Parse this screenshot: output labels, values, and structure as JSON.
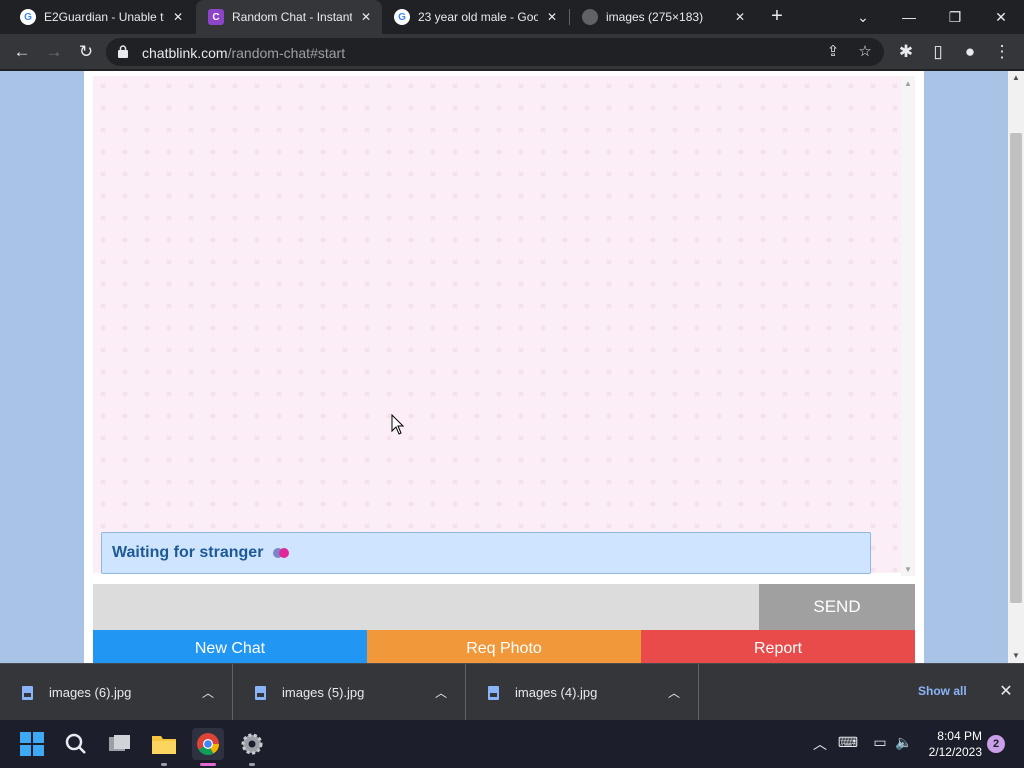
{
  "browser": {
    "tabs": [
      {
        "title": "E2Guardian - Unable to",
        "icon": "google-icon",
        "active": false
      },
      {
        "title": "Random Chat - Instant",
        "icon": "chatblink-icon",
        "active": true
      },
      {
        "title": "23 year old male - Goo",
        "icon": "google-icon",
        "active": false
      },
      {
        "title": "images (275×183)",
        "icon": "globe-icon",
        "active": false
      }
    ],
    "url_domain": "chatblink.com",
    "url_path": "/random-chat#start"
  },
  "chat": {
    "status_text": "Waiting for stranger",
    "message_placeholder": "",
    "send_label": "SEND",
    "new_chat_label": "New Chat",
    "req_photo_label": "Req Photo",
    "report_label": "Report",
    "colors": {
      "new_chat": "#2196f3",
      "req_photo": "#f0983a",
      "report": "#e94b4b",
      "status_bg": "#cfe5ff",
      "status_text": "#1e5a96",
      "chat_bg": "#fbeef6"
    }
  },
  "downloads": {
    "items": [
      {
        "name": "images (6).jpg"
      },
      {
        "name": "images (5).jpg"
      },
      {
        "name": "images (4).jpg"
      }
    ],
    "show_all_label": "Show all"
  },
  "taskbar": {
    "time": "8:04 PM",
    "date": "2/12/2023",
    "notification_count": "2"
  }
}
